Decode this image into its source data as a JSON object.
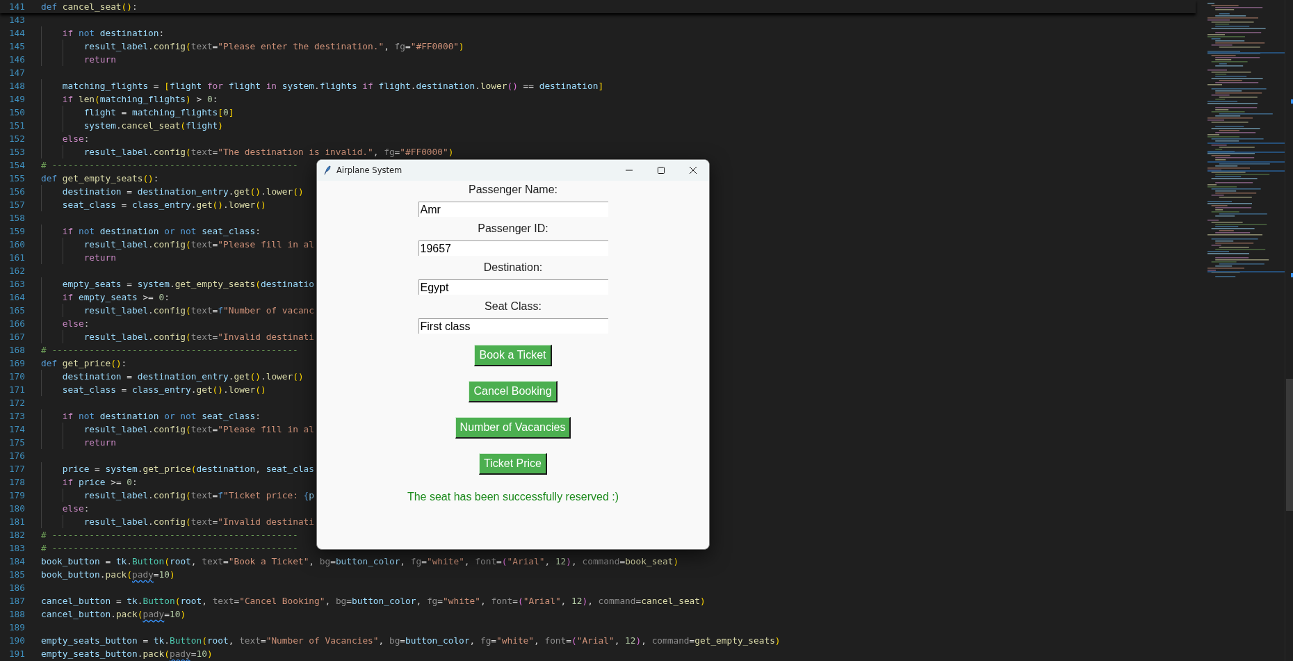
{
  "editor": {
    "sticky_line": {
      "number": "141",
      "tokens": [
        {
          "kind": "keyword",
          "text": "def "
        },
        {
          "kind": "function",
          "text": "cancel_seat"
        },
        {
          "kind": "bracket",
          "text": "()"
        },
        {
          "kind": "plain",
          "text": ":"
        }
      ]
    },
    "lines": [
      {
        "number": "143"
      },
      {
        "number": "144",
        "tokens": [
          {
            "kind": "control",
            "text": "    if "
          },
          {
            "kind": "keyword",
            "text": "not "
          },
          {
            "kind": "variable",
            "text": "destination"
          },
          {
            "kind": "plain",
            "text": ":"
          }
        ]
      },
      {
        "number": "145",
        "tokens": [
          {
            "kind": "variable",
            "text": "        result_label"
          },
          {
            "kind": "plain",
            "text": "."
          },
          {
            "kind": "function",
            "text": "config"
          },
          {
            "kind": "bracket",
            "text": "("
          },
          {
            "kind": "param",
            "text": "text"
          },
          {
            "kind": "plain",
            "text": "="
          },
          {
            "kind": "string",
            "text": "\"Please enter the destination.\""
          },
          {
            "kind": "plain",
            "text": ", "
          },
          {
            "kind": "param",
            "text": "fg"
          },
          {
            "kind": "plain",
            "text": "="
          },
          {
            "kind": "string",
            "text": "\"#FF0000\""
          },
          {
            "kind": "bracket",
            "text": ")"
          }
        ]
      },
      {
        "number": "146",
        "tokens": [
          {
            "kind": "control",
            "text": "        return"
          }
        ]
      },
      {
        "number": "147"
      },
      {
        "number": "148",
        "tokens": [
          {
            "kind": "variable",
            "text": "    matching_flights"
          },
          {
            "kind": "plain",
            "text": " = "
          },
          {
            "kind": "bracket",
            "text": "["
          },
          {
            "kind": "variable",
            "text": "flight "
          },
          {
            "kind": "control",
            "text": "for "
          },
          {
            "kind": "variable",
            "text": "flight "
          },
          {
            "kind": "control",
            "text": "in "
          },
          {
            "kind": "variable",
            "text": "system"
          },
          {
            "kind": "plain",
            "text": "."
          },
          {
            "kind": "variable",
            "text": "flights "
          },
          {
            "kind": "control",
            "text": "if "
          },
          {
            "kind": "variable",
            "text": "flight"
          },
          {
            "kind": "plain",
            "text": "."
          },
          {
            "kind": "variable",
            "text": "destination"
          },
          {
            "kind": "plain",
            "text": "."
          },
          {
            "kind": "function",
            "text": "lower"
          },
          {
            "kind": "bracket2",
            "text": "()"
          },
          {
            "kind": "plain",
            "text": " == "
          },
          {
            "kind": "variable",
            "text": "destination"
          },
          {
            "kind": "bracket",
            "text": "]"
          }
        ]
      },
      {
        "number": "149",
        "tokens": [
          {
            "kind": "control",
            "text": "    if "
          },
          {
            "kind": "function",
            "text": "len"
          },
          {
            "kind": "bracket",
            "text": "("
          },
          {
            "kind": "variable",
            "text": "matching_flights"
          },
          {
            "kind": "bracket",
            "text": ")"
          },
          {
            "kind": "plain",
            "text": " > "
          },
          {
            "kind": "number",
            "text": "0"
          },
          {
            "kind": "plain",
            "text": ":"
          }
        ]
      },
      {
        "number": "150",
        "tokens": [
          {
            "kind": "variable",
            "text": "        flight"
          },
          {
            "kind": "plain",
            "text": " = "
          },
          {
            "kind": "variable",
            "text": "matching_flights"
          },
          {
            "kind": "bracket",
            "text": "["
          },
          {
            "kind": "number",
            "text": "0"
          },
          {
            "kind": "bracket",
            "text": "]"
          }
        ]
      },
      {
        "number": "151",
        "tokens": [
          {
            "kind": "variable",
            "text": "        system"
          },
          {
            "kind": "plain",
            "text": "."
          },
          {
            "kind": "function",
            "text": "cancel_seat"
          },
          {
            "kind": "bracket",
            "text": "("
          },
          {
            "kind": "variable",
            "text": "flight"
          },
          {
            "kind": "bracket",
            "text": ")"
          }
        ]
      },
      {
        "number": "152",
        "tokens": [
          {
            "kind": "control",
            "text": "    else"
          },
          {
            "kind": "plain",
            "text": ":"
          }
        ]
      },
      {
        "number": "153",
        "tokens": [
          {
            "kind": "variable",
            "text": "        result_label"
          },
          {
            "kind": "plain",
            "text": "."
          },
          {
            "kind": "function",
            "text": "config"
          },
          {
            "kind": "bracket",
            "text": "("
          },
          {
            "kind": "param",
            "text": "text"
          },
          {
            "kind": "plain",
            "text": "="
          },
          {
            "kind": "string",
            "text": "\"The destination is invalid.\""
          },
          {
            "kind": "plain",
            "text": ", "
          },
          {
            "kind": "param",
            "text": "fg"
          },
          {
            "kind": "plain",
            "text": "="
          },
          {
            "kind": "string",
            "text": "\"#FF0000\""
          },
          {
            "kind": "bracket",
            "text": ")"
          }
        ]
      },
      {
        "number": "154",
        "tokens": [
          {
            "kind": "comment",
            "text": "# ----------------------------------------------"
          }
        ]
      },
      {
        "number": "155",
        "tokens": [
          {
            "kind": "keyword",
            "text": "def "
          },
          {
            "kind": "function",
            "text": "get_empty_seats"
          },
          {
            "kind": "bracket",
            "text": "()"
          },
          {
            "kind": "plain",
            "text": ":"
          }
        ]
      },
      {
        "number": "156",
        "tokens": [
          {
            "kind": "variable",
            "text": "    destination"
          },
          {
            "kind": "plain",
            "text": " = "
          },
          {
            "kind": "variable",
            "text": "destination_entry"
          },
          {
            "kind": "plain",
            "text": "."
          },
          {
            "kind": "function",
            "text": "get"
          },
          {
            "kind": "bracket",
            "text": "()"
          },
          {
            "kind": "plain",
            "text": "."
          },
          {
            "kind": "function",
            "text": "lower"
          },
          {
            "kind": "bracket",
            "text": "()"
          }
        ]
      },
      {
        "number": "157",
        "tokens": [
          {
            "kind": "variable",
            "text": "    seat_class"
          },
          {
            "kind": "plain",
            "text": " = "
          },
          {
            "kind": "variable",
            "text": "class_entry"
          },
          {
            "kind": "plain",
            "text": "."
          },
          {
            "kind": "function",
            "text": "get"
          },
          {
            "kind": "bracket",
            "text": "()"
          },
          {
            "kind": "plain",
            "text": "."
          },
          {
            "kind": "function",
            "text": "lower"
          },
          {
            "kind": "bracket",
            "text": "()"
          }
        ]
      },
      {
        "number": "158"
      },
      {
        "number": "159",
        "tokens": [
          {
            "kind": "control",
            "text": "    if "
          },
          {
            "kind": "keyword",
            "text": "not "
          },
          {
            "kind": "variable",
            "text": "destination "
          },
          {
            "kind": "keyword",
            "text": "or not "
          },
          {
            "kind": "variable",
            "text": "seat_class"
          },
          {
            "kind": "plain",
            "text": ":"
          }
        ]
      },
      {
        "number": "160",
        "tokens": [
          {
            "kind": "variable",
            "text": "        result_label"
          },
          {
            "kind": "plain",
            "text": "."
          },
          {
            "kind": "function",
            "text": "config"
          },
          {
            "kind": "bracket",
            "text": "("
          },
          {
            "kind": "param",
            "text": "text"
          },
          {
            "kind": "plain",
            "text": "="
          },
          {
            "kind": "string",
            "text": "\"Please fill in al"
          }
        ]
      },
      {
        "number": "161",
        "tokens": [
          {
            "kind": "control",
            "text": "        return"
          }
        ]
      },
      {
        "number": "162"
      },
      {
        "number": "163",
        "tokens": [
          {
            "kind": "variable",
            "text": "    empty_seats"
          },
          {
            "kind": "plain",
            "text": " = "
          },
          {
            "kind": "variable",
            "text": "system"
          },
          {
            "kind": "plain",
            "text": "."
          },
          {
            "kind": "function",
            "text": "get_empty_seats"
          },
          {
            "kind": "bracket",
            "text": "("
          },
          {
            "kind": "variable",
            "text": "destinatio"
          }
        ]
      },
      {
        "number": "164",
        "tokens": [
          {
            "kind": "control",
            "text": "    if "
          },
          {
            "kind": "variable",
            "text": "empty_seats"
          },
          {
            "kind": "plain",
            "text": " >= "
          },
          {
            "kind": "number",
            "text": "0"
          },
          {
            "kind": "plain",
            "text": ":"
          }
        ]
      },
      {
        "number": "165",
        "tokens": [
          {
            "kind": "variable",
            "text": "        result_label"
          },
          {
            "kind": "plain",
            "text": "."
          },
          {
            "kind": "function",
            "text": "config"
          },
          {
            "kind": "bracket",
            "text": "("
          },
          {
            "kind": "param",
            "text": "text"
          },
          {
            "kind": "plain",
            "text": "="
          },
          {
            "kind": "keyword",
            "text": "f"
          },
          {
            "kind": "string",
            "text": "\"Number of vacanc"
          }
        ]
      },
      {
        "number": "166",
        "tokens": [
          {
            "kind": "control",
            "text": "    else"
          },
          {
            "kind": "plain",
            "text": ":"
          }
        ]
      },
      {
        "number": "167",
        "tokens": [
          {
            "kind": "variable",
            "text": "        result_label"
          },
          {
            "kind": "plain",
            "text": "."
          },
          {
            "kind": "function",
            "text": "config"
          },
          {
            "kind": "bracket",
            "text": "("
          },
          {
            "kind": "param",
            "text": "text"
          },
          {
            "kind": "plain",
            "text": "="
          },
          {
            "kind": "string",
            "text": "\"Invalid destinati"
          }
        ]
      },
      {
        "number": "168",
        "tokens": [
          {
            "kind": "comment",
            "text": "# ----------------------------------------------"
          }
        ]
      },
      {
        "number": "169",
        "tokens": [
          {
            "kind": "keyword",
            "text": "def "
          },
          {
            "kind": "function",
            "text": "get_price"
          },
          {
            "kind": "bracket",
            "text": "()"
          },
          {
            "kind": "plain",
            "text": ":"
          }
        ]
      },
      {
        "number": "170",
        "tokens": [
          {
            "kind": "variable",
            "text": "    destination"
          },
          {
            "kind": "plain",
            "text": " = "
          },
          {
            "kind": "variable",
            "text": "destination_entry"
          },
          {
            "kind": "plain",
            "text": "."
          },
          {
            "kind": "function",
            "text": "get"
          },
          {
            "kind": "bracket",
            "text": "()"
          },
          {
            "kind": "plain",
            "text": "."
          },
          {
            "kind": "function",
            "text": "lower"
          },
          {
            "kind": "bracket",
            "text": "()"
          }
        ]
      },
      {
        "number": "171",
        "tokens": [
          {
            "kind": "variable",
            "text": "    seat_class"
          },
          {
            "kind": "plain",
            "text": " = "
          },
          {
            "kind": "variable",
            "text": "class_entry"
          },
          {
            "kind": "plain",
            "text": "."
          },
          {
            "kind": "function",
            "text": "get"
          },
          {
            "kind": "bracket",
            "text": "()"
          },
          {
            "kind": "plain",
            "text": "."
          },
          {
            "kind": "function",
            "text": "lower"
          },
          {
            "kind": "bracket",
            "text": "()"
          }
        ]
      },
      {
        "number": "172"
      },
      {
        "number": "173",
        "tokens": [
          {
            "kind": "control",
            "text": "    if "
          },
          {
            "kind": "keyword",
            "text": "not "
          },
          {
            "kind": "variable",
            "text": "destination "
          },
          {
            "kind": "keyword",
            "text": "or not "
          },
          {
            "kind": "variable",
            "text": "seat_class"
          },
          {
            "kind": "plain",
            "text": ":"
          }
        ]
      },
      {
        "number": "174",
        "tokens": [
          {
            "kind": "variable",
            "text": "        result_label"
          },
          {
            "kind": "plain",
            "text": "."
          },
          {
            "kind": "function",
            "text": "config"
          },
          {
            "kind": "bracket",
            "text": "("
          },
          {
            "kind": "param",
            "text": "text"
          },
          {
            "kind": "plain",
            "text": "="
          },
          {
            "kind": "string",
            "text": "\"Please fill in al"
          }
        ]
      },
      {
        "number": "175",
        "tokens": [
          {
            "kind": "control",
            "text": "        return"
          }
        ]
      },
      {
        "number": "176"
      },
      {
        "number": "177",
        "tokens": [
          {
            "kind": "variable",
            "text": "    price"
          },
          {
            "kind": "plain",
            "text": " = "
          },
          {
            "kind": "variable",
            "text": "system"
          },
          {
            "kind": "plain",
            "text": "."
          },
          {
            "kind": "function",
            "text": "get_price"
          },
          {
            "kind": "bracket",
            "text": "("
          },
          {
            "kind": "variable",
            "text": "destination"
          },
          {
            "kind": "plain",
            "text": ", "
          },
          {
            "kind": "variable",
            "text": "seat_clas"
          }
        ]
      },
      {
        "number": "178",
        "tokens": [
          {
            "kind": "control",
            "text": "    if "
          },
          {
            "kind": "variable",
            "text": "price"
          },
          {
            "kind": "plain",
            "text": " >= "
          },
          {
            "kind": "number",
            "text": "0"
          },
          {
            "kind": "plain",
            "text": ":"
          }
        ]
      },
      {
        "number": "179",
        "tokens": [
          {
            "kind": "variable",
            "text": "        result_label"
          },
          {
            "kind": "plain",
            "text": "."
          },
          {
            "kind": "function",
            "text": "config"
          },
          {
            "kind": "bracket",
            "text": "("
          },
          {
            "kind": "param",
            "text": "text"
          },
          {
            "kind": "plain",
            "text": "="
          },
          {
            "kind": "keyword",
            "text": "f"
          },
          {
            "kind": "string",
            "text": "\"Ticket price: "
          },
          {
            "kind": "keyword",
            "text": "{"
          },
          {
            "kind": "variable",
            "text": "p"
          }
        ]
      },
      {
        "number": "180",
        "tokens": [
          {
            "kind": "control",
            "text": "    else"
          },
          {
            "kind": "plain",
            "text": ":"
          }
        ]
      },
      {
        "number": "181",
        "tokens": [
          {
            "kind": "variable",
            "text": "        result_label"
          },
          {
            "kind": "plain",
            "text": "."
          },
          {
            "kind": "function",
            "text": "config"
          },
          {
            "kind": "bracket",
            "text": "("
          },
          {
            "kind": "param",
            "text": "text"
          },
          {
            "kind": "plain",
            "text": "="
          },
          {
            "kind": "string",
            "text": "\"Invalid destinati"
          }
        ]
      },
      {
        "number": "182",
        "tokens": [
          {
            "kind": "comment",
            "text": "# ----------------------------------------------"
          }
        ]
      },
      {
        "number": "183",
        "tokens": [
          {
            "kind": "comment",
            "text": "# ----------------------------------------------"
          }
        ]
      },
      {
        "number": "184",
        "tokens": [
          {
            "kind": "variable",
            "text": "book_button"
          },
          {
            "kind": "plain",
            "text": " = "
          },
          {
            "kind": "variable",
            "text": "tk"
          },
          {
            "kind": "plain",
            "text": "."
          },
          {
            "kind": "class",
            "text": "Button"
          },
          {
            "kind": "bracket",
            "text": "("
          },
          {
            "kind": "variable",
            "text": "root"
          },
          {
            "kind": "plain",
            "text": ", "
          },
          {
            "kind": "param",
            "text": "text"
          },
          {
            "kind": "plain",
            "text": "="
          },
          {
            "kind": "string",
            "text": "\"Book a Ticket\""
          },
          {
            "kind": "plain",
            "text": ", "
          },
          {
            "kind": "param",
            "text": "bg"
          },
          {
            "kind": "plain",
            "text": "="
          },
          {
            "kind": "variable",
            "text": "button_color"
          },
          {
            "kind": "plain",
            "text": ", "
          },
          {
            "kind": "param",
            "text": "fg"
          },
          {
            "kind": "plain",
            "text": "="
          },
          {
            "kind": "string",
            "text": "\"white\""
          },
          {
            "kind": "plain",
            "text": ", "
          },
          {
            "kind": "param",
            "text": "font"
          },
          {
            "kind": "plain",
            "text": "="
          },
          {
            "kind": "bracket2",
            "text": "("
          },
          {
            "kind": "string",
            "text": "\"Arial\""
          },
          {
            "kind": "plain",
            "text": ", "
          },
          {
            "kind": "number",
            "text": "12"
          },
          {
            "kind": "bracket2",
            "text": ")"
          },
          {
            "kind": "plain",
            "text": ", "
          },
          {
            "kind": "param",
            "text": "command"
          },
          {
            "kind": "plain",
            "text": "="
          },
          {
            "kind": "function",
            "text": "book_seat"
          },
          {
            "kind": "bracket",
            "text": ")"
          }
        ]
      },
      {
        "number": "185",
        "tokens": [
          {
            "kind": "variable",
            "text": "book_button"
          },
          {
            "kind": "plain",
            "text": "."
          },
          {
            "kind": "function",
            "text": "pack"
          },
          {
            "kind": "bracket",
            "text": "("
          },
          {
            "kind": "warning",
            "text": "pady"
          },
          {
            "kind": "plain",
            "text": "="
          },
          {
            "kind": "number",
            "text": "10"
          },
          {
            "kind": "bracket",
            "text": ")"
          }
        ]
      },
      {
        "number": "186"
      },
      {
        "number": "187",
        "tokens": [
          {
            "kind": "variable",
            "text": "cancel_button"
          },
          {
            "kind": "plain",
            "text": " = "
          },
          {
            "kind": "variable",
            "text": "tk"
          },
          {
            "kind": "plain",
            "text": "."
          },
          {
            "kind": "class",
            "text": "Button"
          },
          {
            "kind": "bracket",
            "text": "("
          },
          {
            "kind": "variable",
            "text": "root"
          },
          {
            "kind": "plain",
            "text": ", "
          },
          {
            "kind": "param",
            "text": "text"
          },
          {
            "kind": "plain",
            "text": "="
          },
          {
            "kind": "string",
            "text": "\"Cancel Booking\""
          },
          {
            "kind": "plain",
            "text": ", "
          },
          {
            "kind": "param",
            "text": "bg"
          },
          {
            "kind": "plain",
            "text": "="
          },
          {
            "kind": "variable",
            "text": "button_color"
          },
          {
            "kind": "plain",
            "text": ", "
          },
          {
            "kind": "param",
            "text": "fg"
          },
          {
            "kind": "plain",
            "text": "="
          },
          {
            "kind": "string",
            "text": "\"white\""
          },
          {
            "kind": "plain",
            "text": ", "
          },
          {
            "kind": "param",
            "text": "font"
          },
          {
            "kind": "plain",
            "text": "="
          },
          {
            "kind": "bracket2",
            "text": "("
          },
          {
            "kind": "string",
            "text": "\"Arial\""
          },
          {
            "kind": "plain",
            "text": ", "
          },
          {
            "kind": "number",
            "text": "12"
          },
          {
            "kind": "bracket2",
            "text": ")"
          },
          {
            "kind": "plain",
            "text": ", "
          },
          {
            "kind": "param",
            "text": "command"
          },
          {
            "kind": "plain",
            "text": "="
          },
          {
            "kind": "function",
            "text": "cancel_seat"
          },
          {
            "kind": "bracket",
            "text": ")"
          }
        ]
      },
      {
        "number": "188",
        "tokens": [
          {
            "kind": "variable",
            "text": "cancel_button"
          },
          {
            "kind": "plain",
            "text": "."
          },
          {
            "kind": "function",
            "text": "pack"
          },
          {
            "kind": "bracket",
            "text": "("
          },
          {
            "kind": "warning",
            "text": "pady"
          },
          {
            "kind": "plain",
            "text": "="
          },
          {
            "kind": "number",
            "text": "10"
          },
          {
            "kind": "bracket",
            "text": ")"
          }
        ]
      },
      {
        "number": "189"
      },
      {
        "number": "190",
        "tokens": [
          {
            "kind": "variable",
            "text": "empty_seats_button"
          },
          {
            "kind": "plain",
            "text": " = "
          },
          {
            "kind": "variable",
            "text": "tk"
          },
          {
            "kind": "plain",
            "text": "."
          },
          {
            "kind": "class",
            "text": "Button"
          },
          {
            "kind": "bracket",
            "text": "("
          },
          {
            "kind": "variable",
            "text": "root"
          },
          {
            "kind": "plain",
            "text": ", "
          },
          {
            "kind": "param",
            "text": "text"
          },
          {
            "kind": "plain",
            "text": "="
          },
          {
            "kind": "string",
            "text": "\"Number of Vacancies\""
          },
          {
            "kind": "plain",
            "text": ", "
          },
          {
            "kind": "param",
            "text": "bg"
          },
          {
            "kind": "plain",
            "text": "="
          },
          {
            "kind": "variable",
            "text": "button_color"
          },
          {
            "kind": "plain",
            "text": ", "
          },
          {
            "kind": "param",
            "text": "fg"
          },
          {
            "kind": "plain",
            "text": "="
          },
          {
            "kind": "string",
            "text": "\"white\""
          },
          {
            "kind": "plain",
            "text": ", "
          },
          {
            "kind": "param",
            "text": "font"
          },
          {
            "kind": "plain",
            "text": "="
          },
          {
            "kind": "bracket2",
            "text": "("
          },
          {
            "kind": "string",
            "text": "\"Arial\""
          },
          {
            "kind": "plain",
            "text": ", "
          },
          {
            "kind": "number",
            "text": "12"
          },
          {
            "kind": "bracket2",
            "text": ")"
          },
          {
            "kind": "plain",
            "text": ", "
          },
          {
            "kind": "param",
            "text": "command"
          },
          {
            "kind": "plain",
            "text": "="
          },
          {
            "kind": "function",
            "text": "get_empty_seats"
          },
          {
            "kind": "bracket",
            "text": ")"
          }
        ]
      },
      {
        "number": "191",
        "tokens": [
          {
            "kind": "variable",
            "text": "empty_seats_button"
          },
          {
            "kind": "plain",
            "text": "."
          },
          {
            "kind": "function",
            "text": "pack"
          },
          {
            "kind": "bracket",
            "text": "("
          },
          {
            "kind": "warning",
            "text": "pady"
          },
          {
            "kind": "plain",
            "text": "="
          },
          {
            "kind": "number",
            "text": "10"
          },
          {
            "kind": "bracket",
            "text": ")"
          }
        ]
      }
    ]
  },
  "dialog": {
    "title": "Airplane System",
    "fields": [
      {
        "label": "Passenger Name:",
        "value": "Amr"
      },
      {
        "label": "Passenger ID:",
        "value": "19657"
      },
      {
        "label": "Destination:",
        "value": "Egypt"
      },
      {
        "label": "Seat Class:",
        "value": "First class"
      }
    ],
    "buttons": [
      "Book a Ticket",
      "Cancel Booking",
      "Number of Vacancies",
      "Ticket Price"
    ],
    "status": {
      "text": "The seat has been successfully reserved :)",
      "kind": "success"
    }
  }
}
